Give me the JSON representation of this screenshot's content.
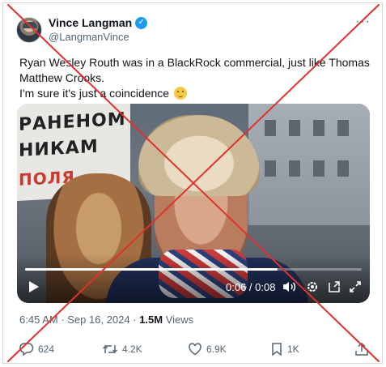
{
  "author": {
    "display_name": "Vince Langman",
    "handle": "@LangmanVince",
    "verified_icon": "verified-badge-icon"
  },
  "tweet": {
    "line1": "Ryan Wesley Routh was in a BlackRock commercial, just like Thomas Matthew Crooks.",
    "line2": "I'm sure it's just a coincidence",
    "emoji_icon": "relieved-face-emoji-icon"
  },
  "video": {
    "sign_lines": [
      "РАНЕНОМ",
      "НИКАМ",
      "ПОЛЯ"
    ],
    "time_current": "0:06",
    "time_separator": " / ",
    "time_total": "0:08",
    "progress_fraction": 0.75
  },
  "meta": {
    "time": "6:45 AM",
    "separator": " · ",
    "date": "Sep 16, 2024",
    "views_count": "1.5M",
    "views_label": " Views"
  },
  "actions": {
    "replies": "624",
    "reposts": "4.2K",
    "likes": "6.9K",
    "bookmarks": "1K"
  },
  "colors": {
    "accent": "#1d9bf0",
    "text": "#0f1419",
    "muted": "#536471",
    "cross": "#e0312a"
  }
}
